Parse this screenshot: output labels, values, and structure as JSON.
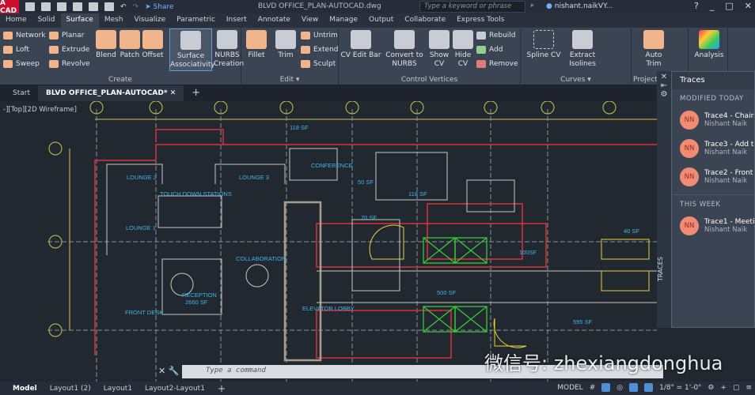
{
  "titlebar": {
    "app_logo": "A CAD",
    "share": "Share",
    "document_title": "BLVD OFFICE_PLAN-AUTOCAD.dwg",
    "search_placeholder": "Type a keyword or phrase",
    "user": "nishant.naikVY..."
  },
  "ribbon_tabs": [
    "Home",
    "Solid",
    "Surface",
    "Mesh",
    "Visualize",
    "Parametric",
    "Insert",
    "Annotate",
    "View",
    "Manage",
    "Output",
    "Collaborate",
    "Express Tools"
  ],
  "active_tab": "Surface",
  "ribbon": {
    "create": {
      "label": "Create",
      "small": [
        "Network",
        "Loft",
        "Sweep",
        "Planar",
        "Extrude",
        "Revolve"
      ],
      "large": [
        "Blend",
        "Patch",
        "Offset"
      ],
      "assoc": [
        "Surface",
        "Associativity"
      ],
      "nurbs": [
        "NURBS",
        "Creation"
      ]
    },
    "edit": {
      "label": "Edit",
      "fillet": "Fillet",
      "trim": "Trim",
      "small": [
        "Untrim",
        "Extend",
        "Sculpt"
      ]
    },
    "cv": {
      "label": "Control Vertices",
      "cv_edit_bar": "CV Edit Bar",
      "convert": [
        "Convert to",
        "NURBS"
      ],
      "show": [
        "Show",
        "CV"
      ],
      "hide": [
        "Hide",
        "CV"
      ],
      "small": [
        "Rebuild",
        "Add",
        "Remove"
      ]
    },
    "curves": {
      "label": "Curves",
      "spline": "Spline CV",
      "extract": [
        "Extract",
        "Isolines"
      ]
    },
    "project": {
      "label": "Project",
      "auto_trim": [
        "Auto",
        "Trim"
      ]
    },
    "analysis": {
      "label": "Analysis"
    }
  },
  "file_tabs": {
    "start": "Start",
    "active": "BLVD OFFICE_PLAN-AUTOCAD*"
  },
  "viewport_label": "-][Top][2D Wireframe]",
  "rooms": {
    "lounge2": "LOUNGE 2",
    "lounge3": "LOUNGE 3",
    "touchdown": "TOUCH DOWN STATIONS",
    "conference": "CONFERENCE",
    "lounge1": "LOUNGE 1",
    "collaboration": "COLLABORATION",
    "reception": "RECEPTION",
    "reception_area": "2660 SF",
    "front_desk": "FRONT DESK",
    "elevator_lobby": "ELEVATOR LOBBY",
    "a118": "118 SF",
    "a50": "50 SF",
    "a118b": "118 SF",
    "a70": "70 SF",
    "a100": "100SF",
    "a500": "500 SF",
    "a595": "595 SF",
    "a40": "40 SF"
  },
  "traces": {
    "title": "Traces",
    "vertical_label": "TRACES",
    "sections": [
      {
        "label": "MODIFIED TODAY",
        "items": [
          {
            "initials": "NN",
            "name": "Trace4 - Chairs",
            "author": "Nishant Naik"
          },
          {
            "initials": "NN",
            "name": "Trace3 - Add ta",
            "author": "Nishant Naik"
          },
          {
            "initials": "NN",
            "name": "Trace2 - Front D",
            "author": "Nishant Naik"
          }
        ]
      },
      {
        "label": "THIS WEEK",
        "items": [
          {
            "initials": "NN",
            "name": "Trace1 - Meetin",
            "author": "Nishant Naik"
          }
        ]
      }
    ]
  },
  "command": {
    "placeholder": "Type a command"
  },
  "layouts": [
    "Model",
    "Layout1 (2)",
    "Layout1",
    "Layout2-Layout1"
  ],
  "status": {
    "model": "MODEL",
    "scale": "1/8\" = 1'-0\""
  },
  "watermark": "微信号: zhexiangdonghua"
}
